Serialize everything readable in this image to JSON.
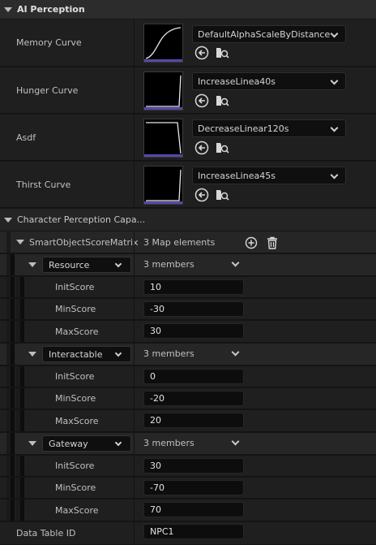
{
  "ai_perception": {
    "header": "AI Perception",
    "curves": [
      {
        "label": "Memory Curve",
        "asset": "DefaultAlphaScaleByDistance",
        "shape": "s-curve"
      },
      {
        "label": "Hunger Curve",
        "asset": "IncreaseLinea40s",
        "shape": "increase"
      },
      {
        "label": "Asdf",
        "asset": "DecreaseLinear120s",
        "shape": "decrease"
      },
      {
        "label": "Thirst Curve",
        "asset": "IncreaseLinea45s",
        "shape": "increase"
      }
    ],
    "icons": {
      "reset": "arrow-left-circle-icon",
      "browse": "folder-search-icon"
    }
  },
  "character_perception": {
    "header": "Character Perception Capa...",
    "matrix": {
      "label": "SmartObjectScoreMatrix",
      "count": "3 Map elements",
      "add_icon": "plus-circle-icon",
      "delete_icon": "trash-icon",
      "entries": [
        {
          "key": "Resource",
          "members": "3 members",
          "init_label": "InitScore",
          "init": "10",
          "min_label": "MinScore",
          "min": "-30",
          "max_label": "MaxScore",
          "max": "30"
        },
        {
          "key": "Interactable",
          "members": "3 members",
          "init_label": "InitScore",
          "init": "0",
          "min_label": "MinScore",
          "min": "-20",
          "max_label": "MaxScore",
          "max": "20"
        },
        {
          "key": "Gateway",
          "members": "3 members",
          "init_label": "InitScore",
          "init": "30",
          "min_label": "MinScore",
          "min": "-70",
          "max_label": "MaxScore",
          "max": "70"
        }
      ]
    }
  },
  "data_table": {
    "label": "Data Table ID",
    "value": "NPC1"
  }
}
